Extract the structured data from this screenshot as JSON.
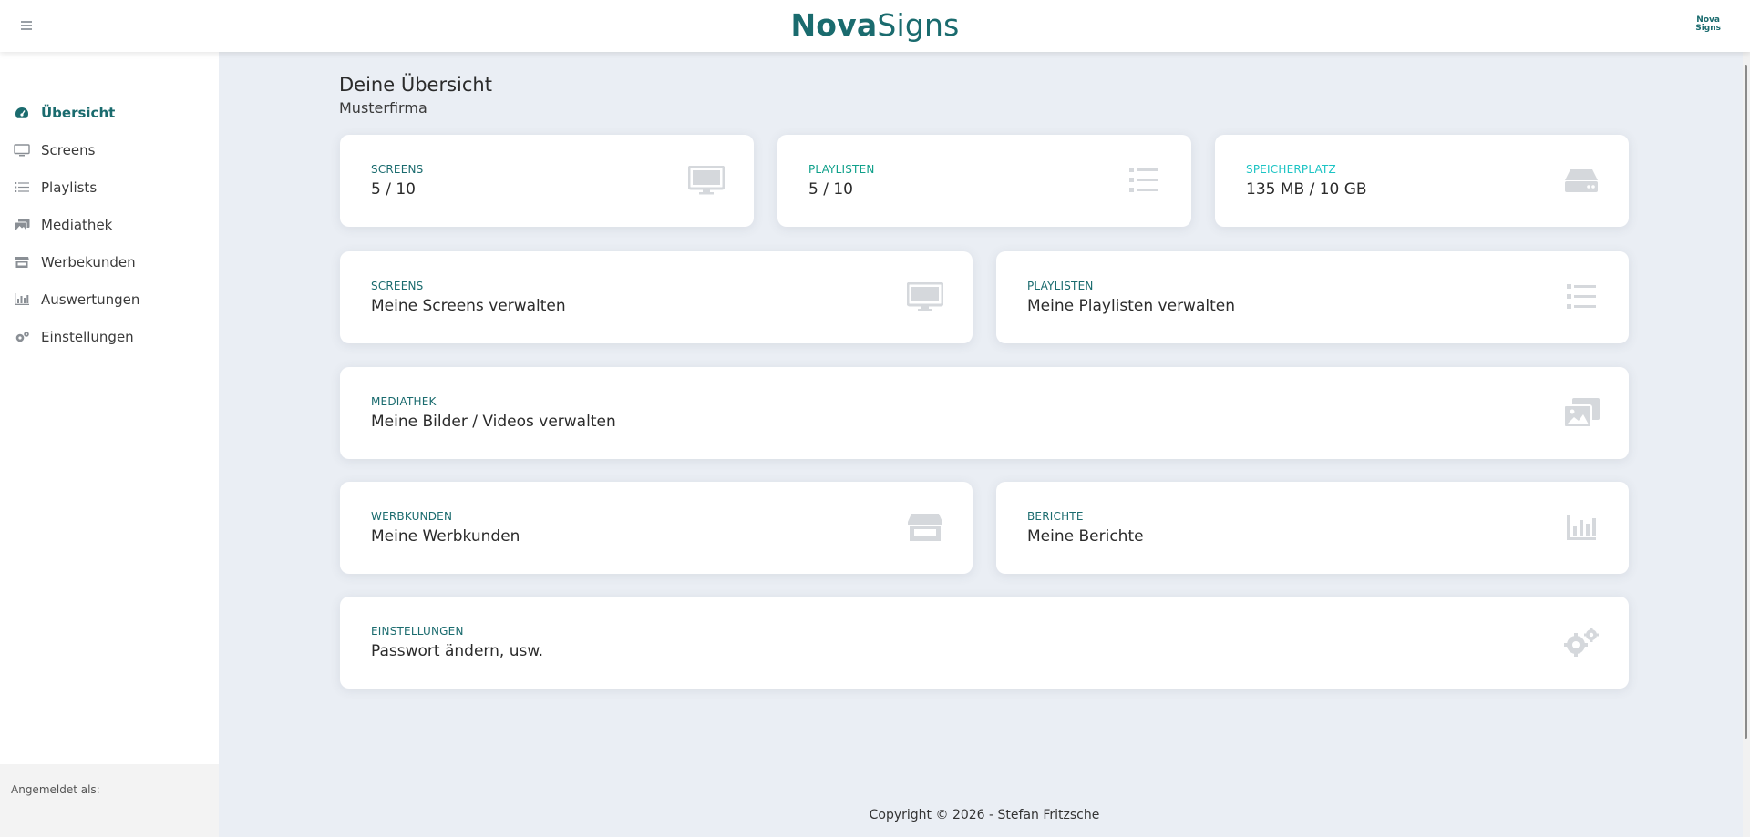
{
  "app": {
    "brand_part1": "Nova",
    "brand_part2": "Signs",
    "mini_logo_line1": "Nova",
    "mini_logo_line2": "Signs",
    "accent": "#1a6b6e"
  },
  "sidebar": {
    "items": [
      {
        "label": "Übersicht",
        "icon": "dashboard-icon",
        "active": true
      },
      {
        "label": "Screens",
        "icon": "monitor-icon"
      },
      {
        "label": "Playlists",
        "icon": "list-icon"
      },
      {
        "label": "Mediathek",
        "icon": "images-icon"
      },
      {
        "label": "Werbekunden",
        "icon": "store-icon"
      },
      {
        "label": "Auswertungen",
        "icon": "bar-chart-icon"
      },
      {
        "label": "Einstellungen",
        "icon": "gears-icon"
      }
    ],
    "footer_label": "Angemeldet als:"
  },
  "page": {
    "title": "Deine Übersicht",
    "subtitle": "Musterfirma"
  },
  "stats": [
    {
      "label": "SCREENS",
      "value": "5 / 10",
      "icon": "monitor-icon",
      "color": "#1a6b6e"
    },
    {
      "label": "PLAYLISTEN",
      "value": "5 / 10",
      "icon": "list-icon",
      "color": "#0fa08a"
    },
    {
      "label": "SPEICHERPLATZ",
      "value": "135 MB / 10 GB",
      "icon": "hdd-icon",
      "color": "#1cc4c4"
    }
  ],
  "cards": {
    "screens": {
      "label": "SCREENS",
      "text": "Meine Screens verwalten"
    },
    "playlists": {
      "label": "PLAYLISTEN",
      "text": "Meine Playlisten verwalten"
    },
    "media": {
      "label": "MEDIATHEK",
      "text": "Meine Bilder / Videos verwalten"
    },
    "clients": {
      "label": "WERBKUNDEN",
      "text": "Meine Werbkunden"
    },
    "reports": {
      "label": "BERICHTE",
      "text": "Meine Berichte"
    },
    "settings": {
      "label": "EINSTELLUNGEN",
      "text": "Passwort ändern, usw."
    }
  },
  "footer": {
    "copyright": "Copyright © 2026 - Stefan Fritzsche"
  }
}
